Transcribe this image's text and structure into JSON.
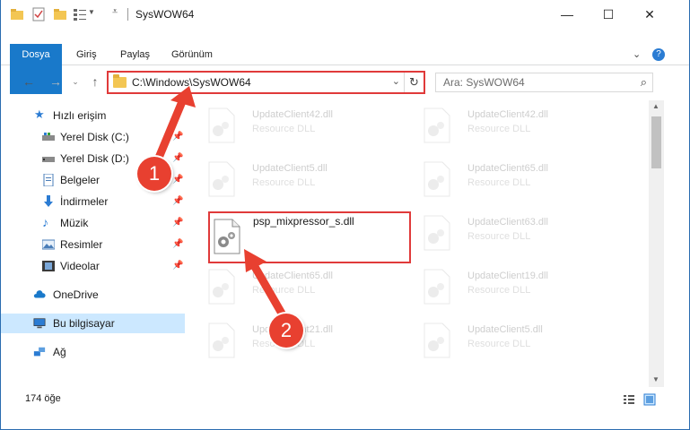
{
  "window": {
    "title": "SysWOW64",
    "controls": {
      "minimize": "—",
      "maximize": "☐",
      "close": "✕"
    }
  },
  "ribbon": {
    "tabs": [
      "Dosya",
      "Giriş",
      "Paylaş",
      "Görünüm"
    ],
    "help": "?"
  },
  "address": {
    "path": "C:\\Windows\\SysWOW64",
    "search_placeholder": "Ara: SysWOW64"
  },
  "nav_pane": {
    "quick_access": "Hızlı erişim",
    "items": [
      {
        "label": "Yerel Disk (C:)",
        "icon": "drive-icon",
        "pinned": true
      },
      {
        "label": "Yerel Disk (D:)",
        "icon": "drive-icon",
        "pinned": true
      },
      {
        "label": "Belgeler",
        "icon": "documents-icon",
        "pinned": true
      },
      {
        "label": "İndirmeler",
        "icon": "downloads-icon",
        "pinned": true
      },
      {
        "label": "Müzik",
        "icon": "music-icon",
        "pinned": true
      },
      {
        "label": "Resimler",
        "icon": "pictures-icon",
        "pinned": true
      },
      {
        "label": "Videolar",
        "icon": "videos-icon",
        "pinned": true
      }
    ],
    "onedrive": "OneDrive",
    "this_pc": "Bu bilgisayar",
    "network": "Ağ"
  },
  "files": {
    "left": [
      {
        "name": "UpdateClient42.dll",
        "type": "Resource DLL"
      },
      {
        "name": "UpdateClient5.dll",
        "type": "Resource DLL"
      },
      {
        "name": "psp_mixpressor_s.dll",
        "type": ""
      },
      {
        "name": "UpdateClient65.dll",
        "type": "Resource DLL"
      },
      {
        "name": "UpdateClient21.dll",
        "type": "Resource DLL"
      }
    ],
    "right": [
      {
        "name": "UpdateClient42.dll",
        "type": "Resource DLL"
      },
      {
        "name": "UpdateClient65.dll",
        "type": "Resource DLL"
      },
      {
        "name": "UpdateClient63.dll",
        "type": "Resource DLL"
      },
      {
        "name": "UpdateClient19.dll",
        "type": "Resource DLL"
      },
      {
        "name": "UpdateClient5.dll",
        "type": "Resource DLL"
      }
    ]
  },
  "status": {
    "count": "174 öğe"
  },
  "callouts": {
    "step1": "1",
    "step2": "2"
  },
  "colors": {
    "accent": "#1979ca",
    "highlight": "#e03a3a",
    "callout": "#e84030",
    "selected": "#cce8ff"
  }
}
